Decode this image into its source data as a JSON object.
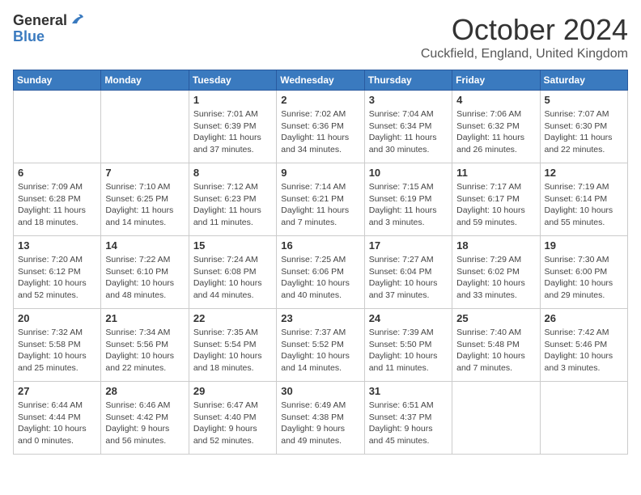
{
  "header": {
    "logo_general": "General",
    "logo_blue": "Blue",
    "month_title": "October 2024",
    "location": "Cuckfield, England, United Kingdom"
  },
  "days_of_week": [
    "Sunday",
    "Monday",
    "Tuesday",
    "Wednesday",
    "Thursday",
    "Friday",
    "Saturday"
  ],
  "weeks": [
    [
      {
        "day": "",
        "info": ""
      },
      {
        "day": "",
        "info": ""
      },
      {
        "day": "1",
        "info": "Sunrise: 7:01 AM\nSunset: 6:39 PM\nDaylight: 11 hours and 37 minutes."
      },
      {
        "day": "2",
        "info": "Sunrise: 7:02 AM\nSunset: 6:36 PM\nDaylight: 11 hours and 34 minutes."
      },
      {
        "day": "3",
        "info": "Sunrise: 7:04 AM\nSunset: 6:34 PM\nDaylight: 11 hours and 30 minutes."
      },
      {
        "day": "4",
        "info": "Sunrise: 7:06 AM\nSunset: 6:32 PM\nDaylight: 11 hours and 26 minutes."
      },
      {
        "day": "5",
        "info": "Sunrise: 7:07 AM\nSunset: 6:30 PM\nDaylight: 11 hours and 22 minutes."
      }
    ],
    [
      {
        "day": "6",
        "info": "Sunrise: 7:09 AM\nSunset: 6:28 PM\nDaylight: 11 hours and 18 minutes."
      },
      {
        "day": "7",
        "info": "Sunrise: 7:10 AM\nSunset: 6:25 PM\nDaylight: 11 hours and 14 minutes."
      },
      {
        "day": "8",
        "info": "Sunrise: 7:12 AM\nSunset: 6:23 PM\nDaylight: 11 hours and 11 minutes."
      },
      {
        "day": "9",
        "info": "Sunrise: 7:14 AM\nSunset: 6:21 PM\nDaylight: 11 hours and 7 minutes."
      },
      {
        "day": "10",
        "info": "Sunrise: 7:15 AM\nSunset: 6:19 PM\nDaylight: 11 hours and 3 minutes."
      },
      {
        "day": "11",
        "info": "Sunrise: 7:17 AM\nSunset: 6:17 PM\nDaylight: 10 hours and 59 minutes."
      },
      {
        "day": "12",
        "info": "Sunrise: 7:19 AM\nSunset: 6:14 PM\nDaylight: 10 hours and 55 minutes."
      }
    ],
    [
      {
        "day": "13",
        "info": "Sunrise: 7:20 AM\nSunset: 6:12 PM\nDaylight: 10 hours and 52 minutes."
      },
      {
        "day": "14",
        "info": "Sunrise: 7:22 AM\nSunset: 6:10 PM\nDaylight: 10 hours and 48 minutes."
      },
      {
        "day": "15",
        "info": "Sunrise: 7:24 AM\nSunset: 6:08 PM\nDaylight: 10 hours and 44 minutes."
      },
      {
        "day": "16",
        "info": "Sunrise: 7:25 AM\nSunset: 6:06 PM\nDaylight: 10 hours and 40 minutes."
      },
      {
        "day": "17",
        "info": "Sunrise: 7:27 AM\nSunset: 6:04 PM\nDaylight: 10 hours and 37 minutes."
      },
      {
        "day": "18",
        "info": "Sunrise: 7:29 AM\nSunset: 6:02 PM\nDaylight: 10 hours and 33 minutes."
      },
      {
        "day": "19",
        "info": "Sunrise: 7:30 AM\nSunset: 6:00 PM\nDaylight: 10 hours and 29 minutes."
      }
    ],
    [
      {
        "day": "20",
        "info": "Sunrise: 7:32 AM\nSunset: 5:58 PM\nDaylight: 10 hours and 25 minutes."
      },
      {
        "day": "21",
        "info": "Sunrise: 7:34 AM\nSunset: 5:56 PM\nDaylight: 10 hours and 22 minutes."
      },
      {
        "day": "22",
        "info": "Sunrise: 7:35 AM\nSunset: 5:54 PM\nDaylight: 10 hours and 18 minutes."
      },
      {
        "day": "23",
        "info": "Sunrise: 7:37 AM\nSunset: 5:52 PM\nDaylight: 10 hours and 14 minutes."
      },
      {
        "day": "24",
        "info": "Sunrise: 7:39 AM\nSunset: 5:50 PM\nDaylight: 10 hours and 11 minutes."
      },
      {
        "day": "25",
        "info": "Sunrise: 7:40 AM\nSunset: 5:48 PM\nDaylight: 10 hours and 7 minutes."
      },
      {
        "day": "26",
        "info": "Sunrise: 7:42 AM\nSunset: 5:46 PM\nDaylight: 10 hours and 3 minutes."
      }
    ],
    [
      {
        "day": "27",
        "info": "Sunrise: 6:44 AM\nSunset: 4:44 PM\nDaylight: 10 hours and 0 minutes."
      },
      {
        "day": "28",
        "info": "Sunrise: 6:46 AM\nSunset: 4:42 PM\nDaylight: 9 hours and 56 minutes."
      },
      {
        "day": "29",
        "info": "Sunrise: 6:47 AM\nSunset: 4:40 PM\nDaylight: 9 hours and 52 minutes."
      },
      {
        "day": "30",
        "info": "Sunrise: 6:49 AM\nSunset: 4:38 PM\nDaylight: 9 hours and 49 minutes."
      },
      {
        "day": "31",
        "info": "Sunrise: 6:51 AM\nSunset: 4:37 PM\nDaylight: 9 hours and 45 minutes."
      },
      {
        "day": "",
        "info": ""
      },
      {
        "day": "",
        "info": ""
      }
    ]
  ]
}
